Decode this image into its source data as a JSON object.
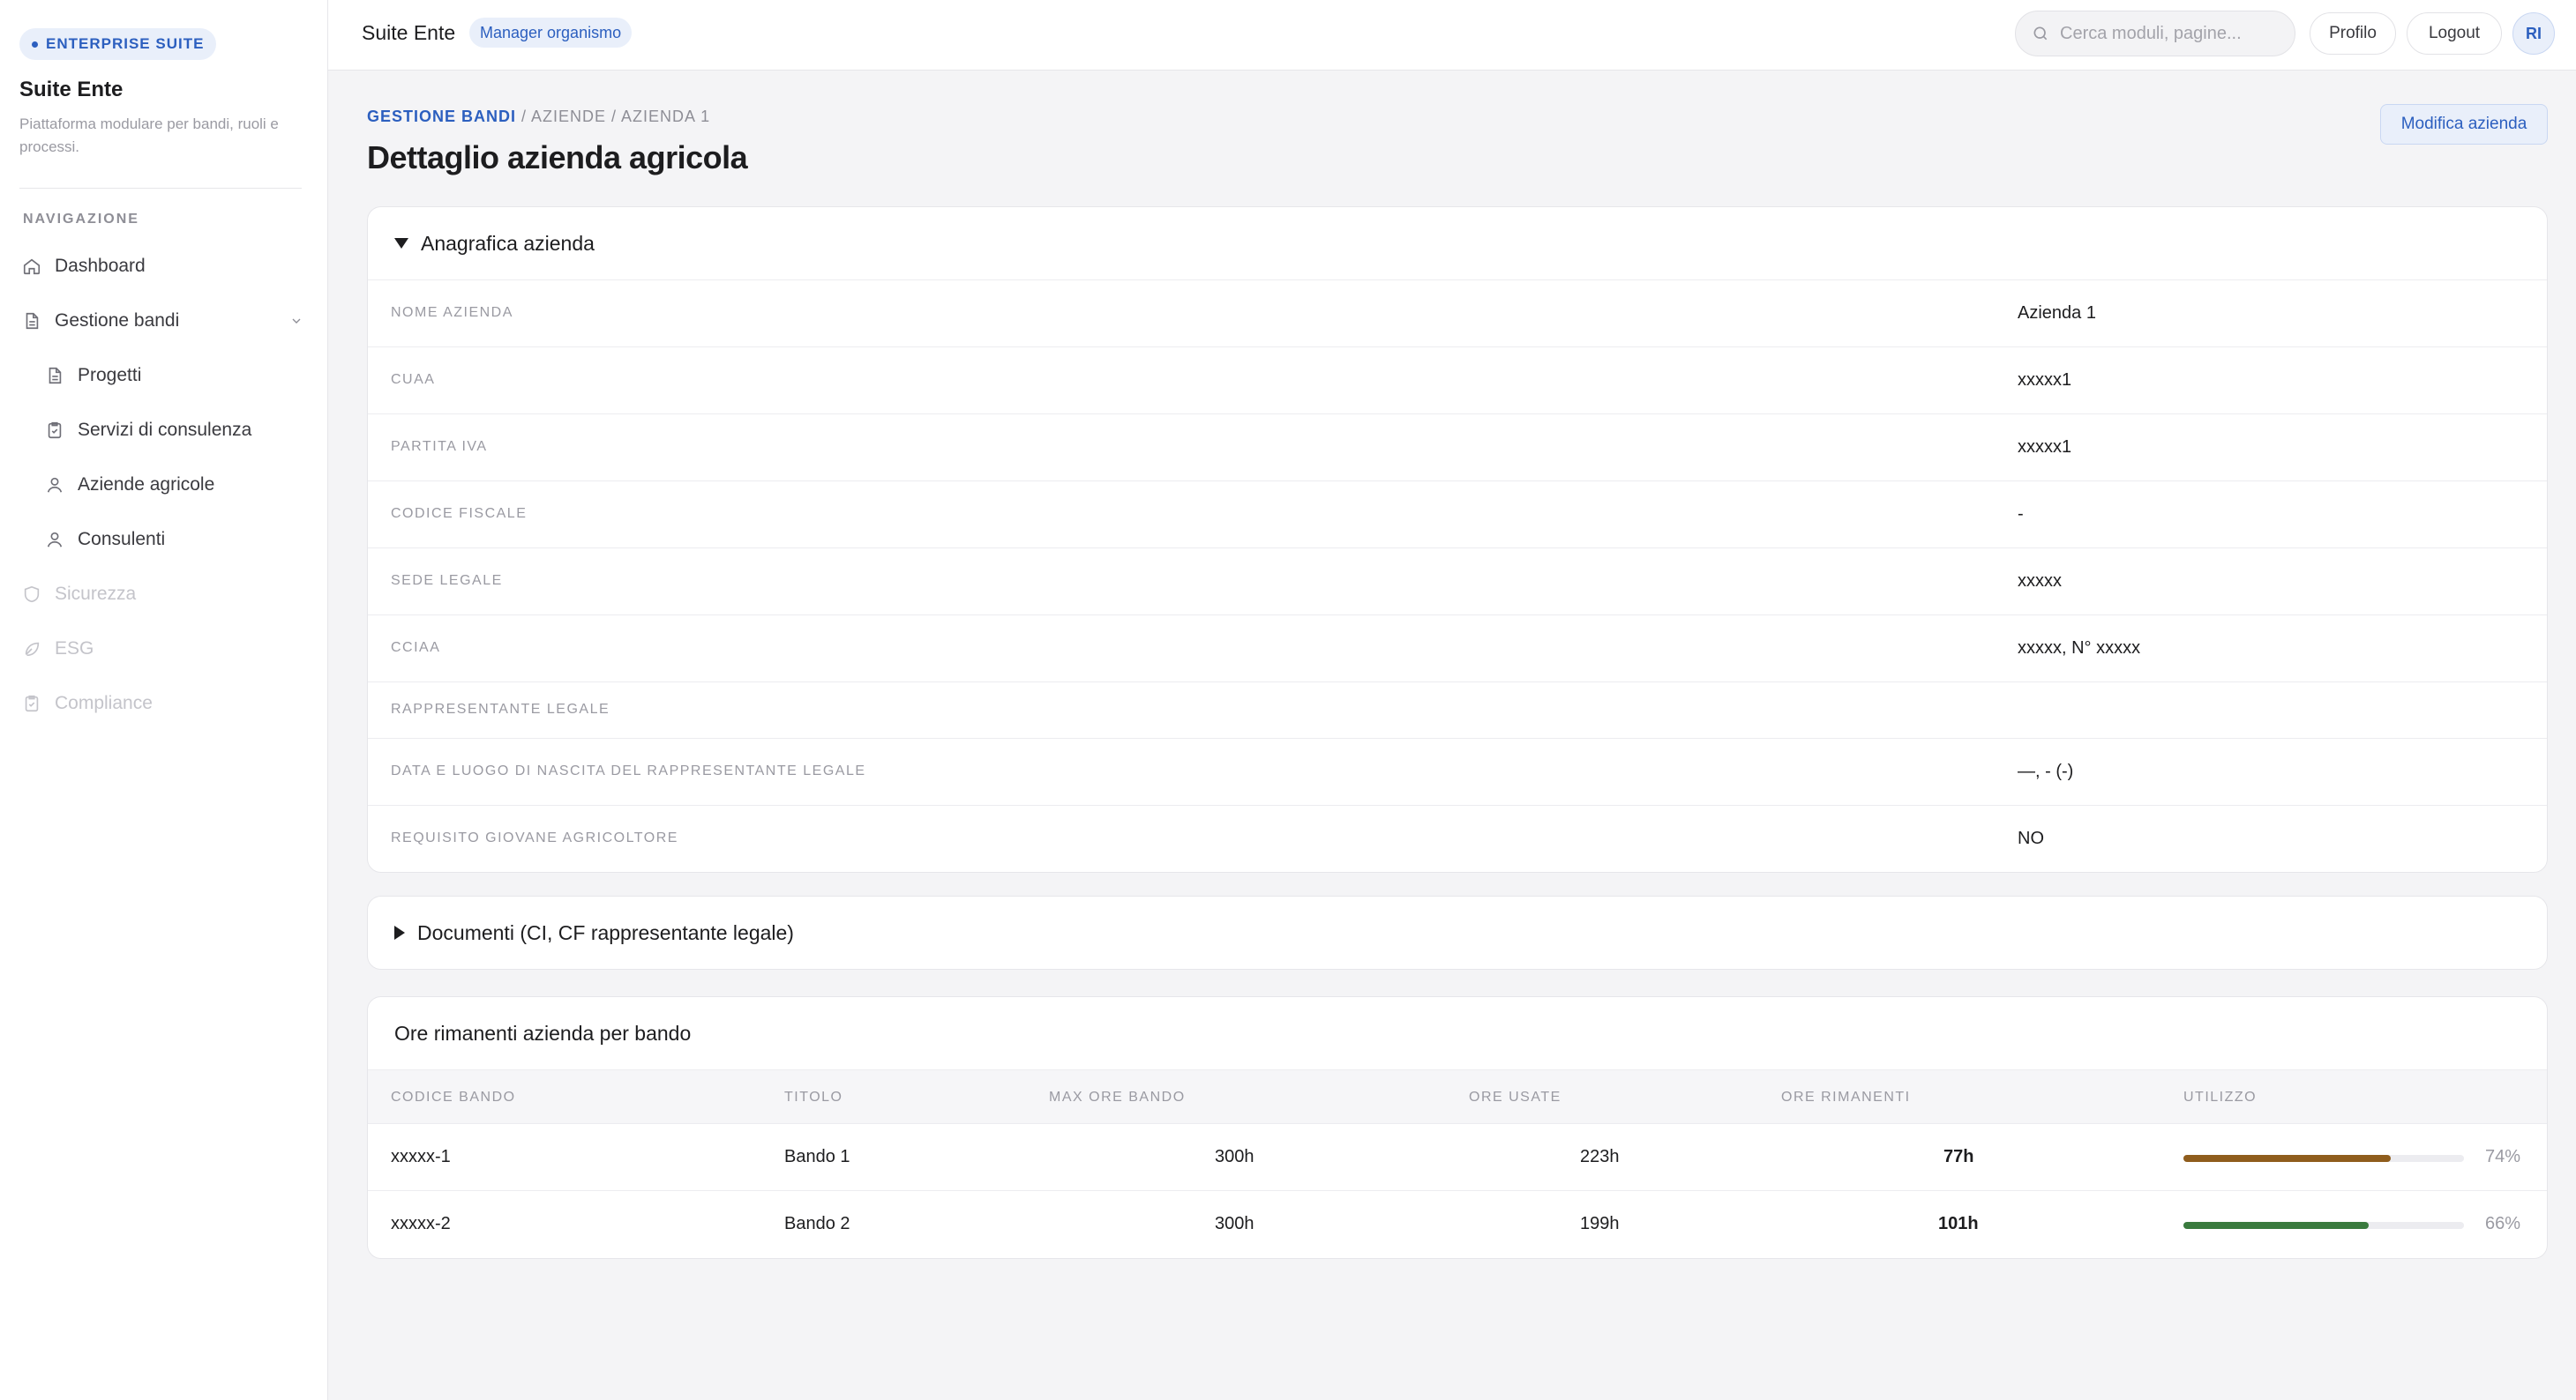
{
  "sidebar": {
    "badge": "ENTERPRISE SUITE",
    "title": "Suite Ente",
    "description": "Piattaforma modulare per bandi, ruoli e processi.",
    "nav_heading": "NAVIGAZIONE",
    "items": [
      {
        "label": "Dashboard",
        "icon": "home-icon"
      },
      {
        "label": "Gestione bandi",
        "icon": "document-icon",
        "expanded": true
      },
      {
        "label": "Progetti",
        "icon": "document-icon"
      },
      {
        "label": "Servizi di consulenza",
        "icon": "clipboard-icon"
      },
      {
        "label": "Aziende agricole",
        "icon": "user-icon"
      },
      {
        "label": "Consulenti",
        "icon": "user-icon"
      },
      {
        "label": "Sicurezza",
        "icon": "shield-icon",
        "disabled": true
      },
      {
        "label": "ESG",
        "icon": "leaf-icon",
        "disabled": true
      },
      {
        "label": "Compliance",
        "icon": "clipboard-check-icon",
        "disabled": true
      }
    ]
  },
  "topbar": {
    "title": "Suite Ente",
    "role": "Manager organismo",
    "search_placeholder": "Cerca moduli, pagine...",
    "profile_label": "Profilo",
    "logout_label": "Logout",
    "avatar_initials": "RI"
  },
  "page": {
    "breadcrumb": {
      "root": "GESTIONE BANDI",
      "rest": " / AZIENDE / AZIENDA 1"
    },
    "title": "Dettaglio azienda agricola",
    "edit_label": "Modifica azienda"
  },
  "anagrafica": {
    "title": "Anagrafica azienda",
    "fields": [
      {
        "label": "NOME AZIENDA",
        "value": "Azienda 1"
      },
      {
        "label": "CUAA",
        "value": "xxxxx1"
      },
      {
        "label": "PARTITA IVA",
        "value": "xxxxx1"
      },
      {
        "label": "CODICE FISCALE",
        "value": "-"
      },
      {
        "label": "SEDE LEGALE",
        "value": "xxxxx"
      },
      {
        "label": "CCIAA",
        "value": "xxxxx, N° xxxxx"
      },
      {
        "label": "RAPPRESENTANTE LEGALE",
        "value": ""
      },
      {
        "label": "DATA E LUOGO DI NASCITA DEL RAPPRESENTANTE LEGALE",
        "value": "—, - (-)"
      },
      {
        "label": "REQUISITO GIOVANE AGRICOLTORE",
        "value": "NO"
      }
    ]
  },
  "documenti": {
    "title": "Documenti (CI, CF rappresentante legale)"
  },
  "ore": {
    "title": "Ore rimanenti azienda per bando",
    "columns": [
      "CODICE BANDO",
      "TITOLO",
      "MAX ORE BANDO",
      "ORE USATE",
      "ORE RIMANENTI",
      "UTILIZZO"
    ],
    "rows": [
      {
        "code": "xxxxx-1",
        "title": "Bando 1",
        "max": "300h",
        "used": "223h",
        "remaining": "77h",
        "usage_pct": 74,
        "usage_label": "74%",
        "bar_color": "#8f5d1d"
      },
      {
        "code": "xxxxx-2",
        "title": "Bando 2",
        "max": "300h",
        "used": "199h",
        "remaining": "101h",
        "usage_pct": 66,
        "usage_label": "66%",
        "bar_color": "#3a7a3e"
      }
    ]
  }
}
